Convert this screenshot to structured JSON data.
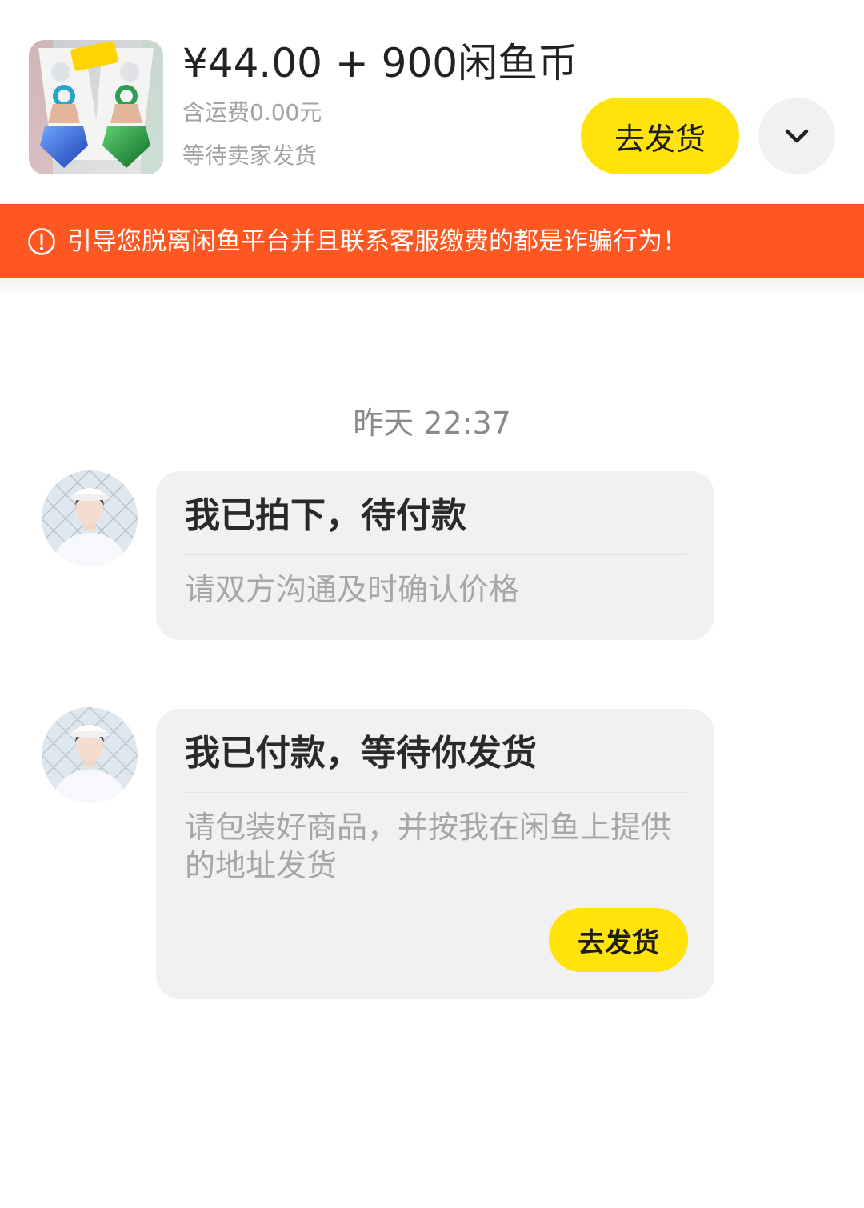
{
  "product": {
    "price": "¥44.00 + 900闲鱼币",
    "shipping": "含运费0.00元",
    "status": "等待卖家发货",
    "ship_button": "去发货",
    "expand_icon": "chevron-down-icon"
  },
  "warning": {
    "icon": "exclamation-circle-icon",
    "text": "引导您脱离闲鱼平台并且联系客服缴费的都是诈骗行为！"
  },
  "chat": {
    "timestamp": "昨天 22:37",
    "messages": [
      {
        "title": "我已拍下，待付款",
        "body": "请双方沟通及时确认价格"
      },
      {
        "title": "我已付款，等待你发货",
        "body": "请包装好商品，并按我在闲鱼上提供的地址发货",
        "button": "去发货"
      }
    ]
  },
  "colors": {
    "accent_yellow": "#ffe30a",
    "warning_orange": "#ff5722",
    "card_gray": "#f1f1f3"
  }
}
